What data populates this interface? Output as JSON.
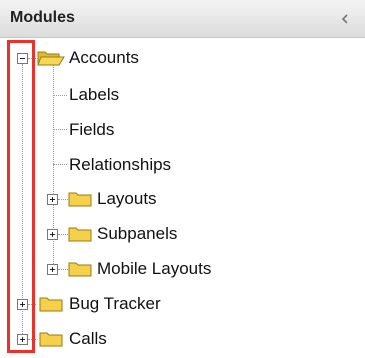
{
  "panel": {
    "title": "Modules",
    "collapse_icon": "chevron-left-icon"
  },
  "tree": {
    "accounts": {
      "label": "Accounts",
      "children": {
        "labels": "Labels",
        "fields": "Fields",
        "relationships": "Relationships",
        "layouts": "Layouts",
        "subpanels": "Subpanels",
        "mobile_layouts": "Mobile Layouts"
      }
    },
    "bug_tracker": "Bug Tracker",
    "calls": "Calls"
  },
  "colors": {
    "highlight": "#e8322c",
    "folder": "#f5d04a"
  }
}
